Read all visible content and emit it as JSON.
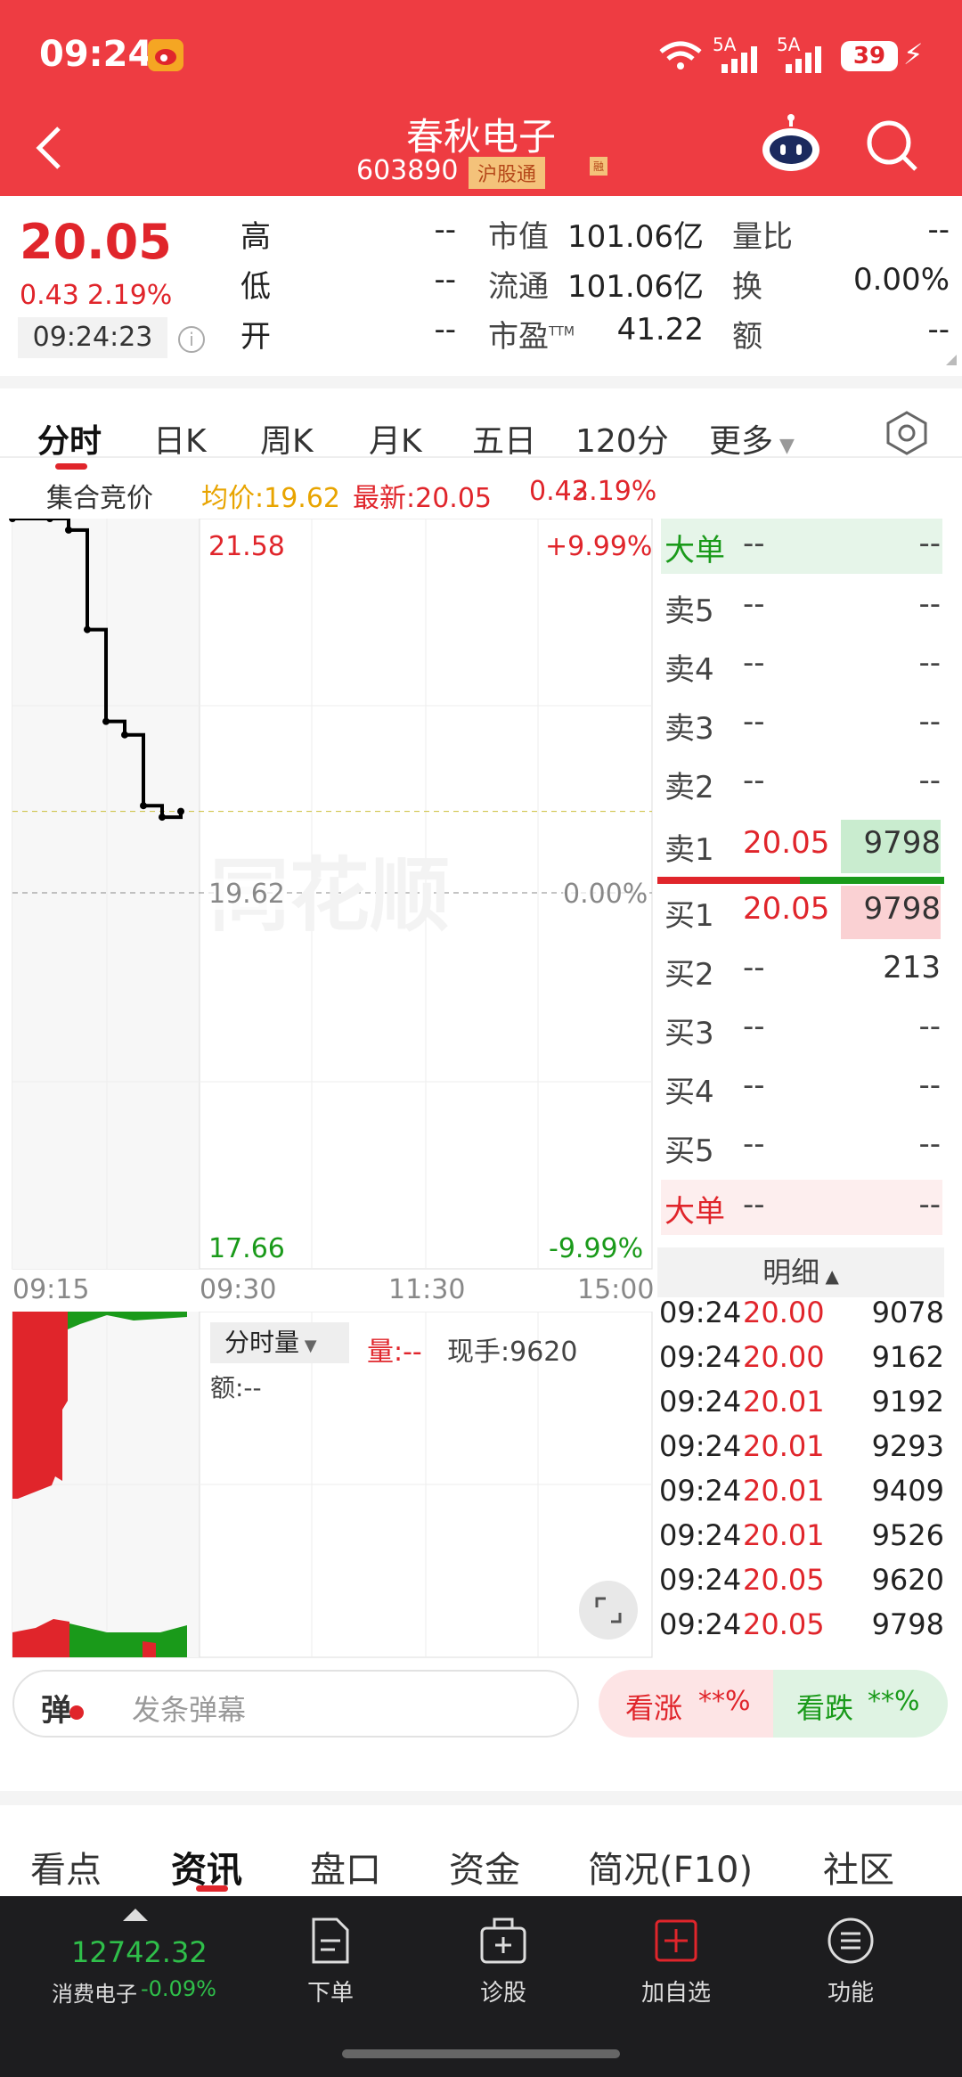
{
  "status": {
    "time": "09:24",
    "net1": "5A",
    "net2": "5A",
    "battery": "39"
  },
  "header": {
    "title": "春秋电子",
    "code": "603890",
    "tag": "沪股通",
    "tag2": "融"
  },
  "quote": {
    "price": "20.05",
    "change": "0.43",
    "change_pct": "2.19%",
    "time": "09:24:23",
    "fields": [
      {
        "label": "高",
        "value": "--"
      },
      {
        "label": "低",
        "value": "--"
      },
      {
        "label": "开",
        "value": "--"
      },
      {
        "label": "市值",
        "value": "101.06亿"
      },
      {
        "label": "流通",
        "value": "101.06亿"
      },
      {
        "label": "市盈TTM",
        "value": "41.22"
      },
      {
        "label": "量比",
        "value": "--"
      },
      {
        "label": "换",
        "value": "0.00%"
      },
      {
        "label": "额",
        "value": "--"
      }
    ]
  },
  "tabs": [
    "分时",
    "日K",
    "周K",
    "月K",
    "五日",
    "120分",
    "更多"
  ],
  "chart": {
    "auction_label": "集合竞价",
    "avg_label": "均价:19.62",
    "latest_label": "最新:20.05",
    "latest_change": "0.43",
    "latest_pct": "2.19%",
    "high_price": "21.58",
    "high_pct": "+9.99%",
    "mid_price": "19.62",
    "mid_pct": "0.00%",
    "low_price": "17.66",
    "low_pct": "-9.99%",
    "times": [
      "09:15",
      "09:30",
      "11:30",
      "15:00"
    ],
    "vol_dropdown": "分时量",
    "vol_label": "量:--",
    "vol_now": "现手:9620",
    "amount_label": "额:--",
    "watermark": "同花顺"
  },
  "chart_data": {
    "type": "line",
    "title": "",
    "xlabel": "",
    "ylabel": "",
    "x": [
      "09:15",
      "09:17",
      "09:18",
      "09:19",
      "09:20",
      "09:21",
      "09:22",
      "09:23",
      "09:24"
    ],
    "series": [
      {
        "name": "",
        "values": [
          21.58,
          21.58,
          21.52,
          21.0,
          20.52,
          20.45,
          20.08,
          20.02,
          20.05
        ]
      }
    ],
    "ylim": [
      17.66,
      21.58
    ],
    "ref_line": 19.62,
    "grid": true
  },
  "orderbook": {
    "big_sell": {
      "label": "大单",
      "price": "--",
      "vol": "--"
    },
    "sells": [
      {
        "label": "卖5",
        "price": "--",
        "vol": "--"
      },
      {
        "label": "卖4",
        "price": "--",
        "vol": "--"
      },
      {
        "label": "卖3",
        "price": "--",
        "vol": "--"
      },
      {
        "label": "卖2",
        "price": "--",
        "vol": "--"
      },
      {
        "label": "卖1",
        "price": "20.05",
        "vol": "9798"
      }
    ],
    "buys": [
      {
        "label": "买1",
        "price": "20.05",
        "vol": "9798"
      },
      {
        "label": "买2",
        "price": "--",
        "vol": "213"
      },
      {
        "label": "买3",
        "price": "--",
        "vol": "--"
      },
      {
        "label": "买4",
        "price": "--",
        "vol": "--"
      },
      {
        "label": "买5",
        "price": "--",
        "vol": "--"
      }
    ],
    "big_buy": {
      "label": "大单",
      "price": "--",
      "vol": "--"
    },
    "detail_label": "明细"
  },
  "ticks": [
    {
      "time": "09:24",
      "price": "20.00",
      "vol": "9078"
    },
    {
      "time": "09:24",
      "price": "20.00",
      "vol": "9162"
    },
    {
      "time": "09:24",
      "price": "20.01",
      "vol": "9192"
    },
    {
      "time": "09:24",
      "price": "20.01",
      "vol": "9293"
    },
    {
      "time": "09:24",
      "price": "20.01",
      "vol": "9409"
    },
    {
      "time": "09:24",
      "price": "20.01",
      "vol": "9526"
    },
    {
      "time": "09:24",
      "price": "20.05",
      "vol": "9620"
    },
    {
      "time": "09:24",
      "price": "20.05",
      "vol": "9798"
    }
  ],
  "danmaku": {
    "icon_label": "弹",
    "placeholder": "发条弹幕",
    "up_label": "看涨",
    "up_val": "**%",
    "down_label": "看跌",
    "down_val": "**%"
  },
  "bottom_tabs": [
    "看点",
    "资讯",
    "盘口",
    "资金",
    "简况(F10)",
    "社区"
  ],
  "nav": {
    "index_value": "12742.32",
    "index_name": "消费电子",
    "index_change": "-0.09%",
    "items": [
      "下单",
      "诊股",
      "加自选",
      "功能"
    ]
  }
}
